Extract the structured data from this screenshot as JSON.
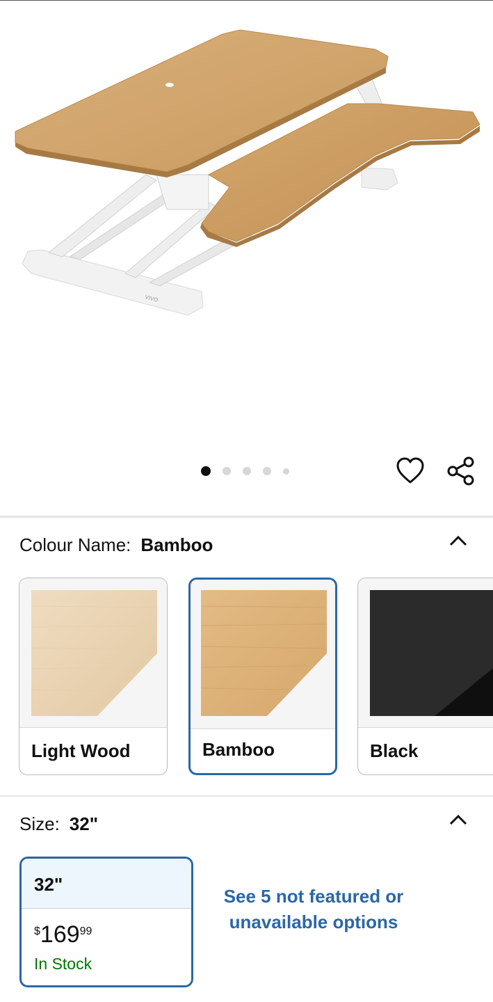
{
  "gallery": {
    "dot_count": 5,
    "active_dot": 1
  },
  "colour": {
    "label": "Colour Name:",
    "selected": "Bamboo",
    "options": [
      {
        "label": "Light Wood"
      },
      {
        "label": "Bamboo"
      },
      {
        "label": "Black"
      }
    ]
  },
  "size": {
    "label": "Size:",
    "selected": "32\"",
    "option": {
      "label": "32\"",
      "price_symbol": "$",
      "price_whole": "169",
      "price_fraction": "99",
      "stock": "In Stock"
    },
    "see_more": "See 5 not featured or unavailable options"
  },
  "colors": {
    "accent": "#2a67a6",
    "in_stock": "#007600"
  },
  "icons": {
    "wishlist": "heart-icon",
    "share": "share-icon",
    "collapse": "chevron-up-icon"
  }
}
